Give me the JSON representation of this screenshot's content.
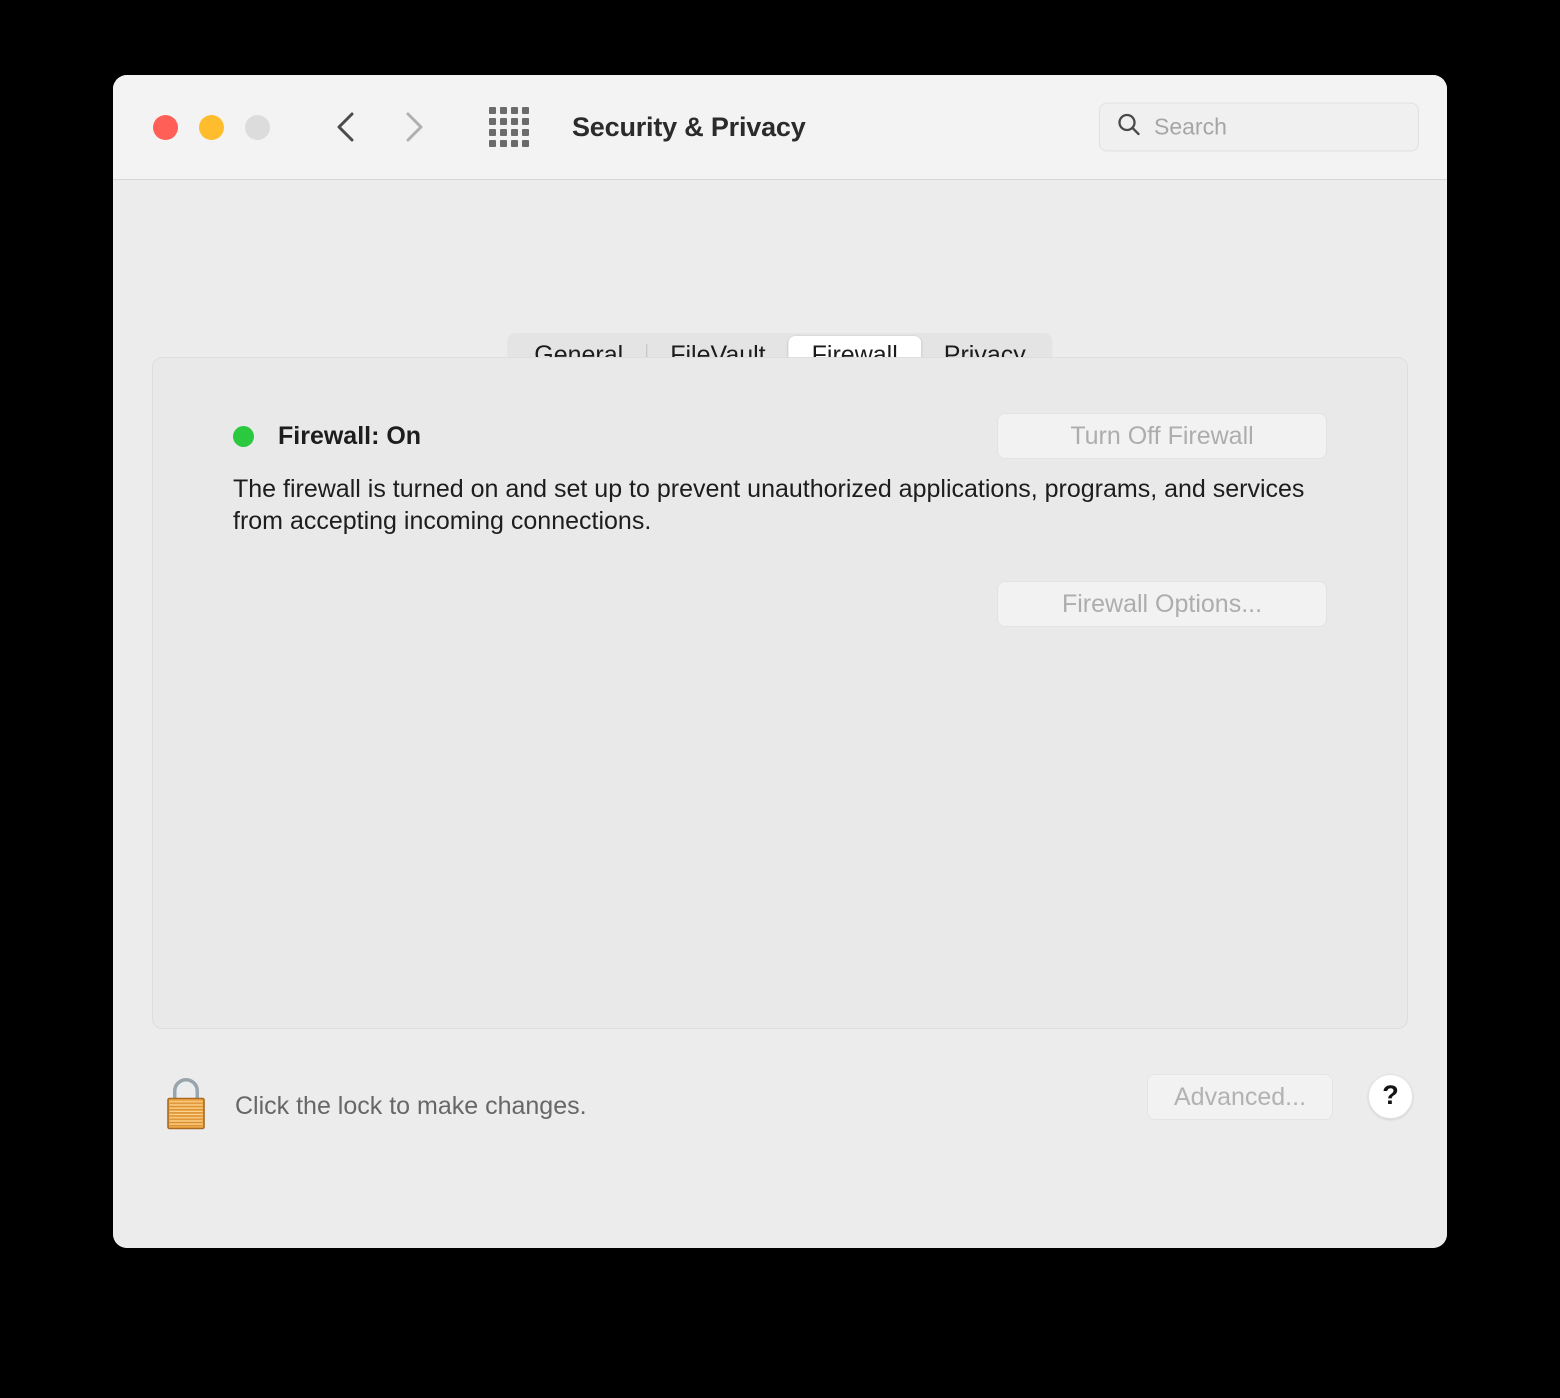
{
  "window": {
    "title": "Security & Privacy",
    "traffic_lights": [
      {
        "name": "close",
        "color": "#ff5f57"
      },
      {
        "name": "minimize",
        "color": "#ffbd2e"
      },
      {
        "name": "zoom",
        "color": "#dcdcdc"
      }
    ],
    "nav": {
      "back_icon": "chevron-left-icon",
      "forward_icon": "chevron-right-icon"
    },
    "show_all_icon": "grid-icon"
  },
  "search": {
    "icon": "search-icon",
    "placeholder": "Search",
    "value": ""
  },
  "tabs": [
    {
      "label": "General",
      "selected": false
    },
    {
      "label": "FileVault",
      "selected": false
    },
    {
      "label": "Firewall",
      "selected": true
    },
    {
      "label": "Privacy",
      "selected": false
    }
  ],
  "panel": {
    "status": {
      "dot_color": "#2ac940",
      "label": "Firewall: On"
    },
    "turn_off_button": {
      "label": "Turn Off Firewall",
      "enabled": false
    },
    "description": "The firewall is turned on and set up to prevent unauthorized applications, programs, and services from accepting incoming connections.",
    "options_button": {
      "label": "Firewall Options...",
      "enabled": false
    }
  },
  "footer": {
    "lock_icon": "lock-closed-icon",
    "lock_text": "Click the lock to make changes.",
    "advanced_button": {
      "label": "Advanced...",
      "enabled": false
    },
    "help_button": {
      "label": "?",
      "icon": "question-mark-icon"
    }
  }
}
